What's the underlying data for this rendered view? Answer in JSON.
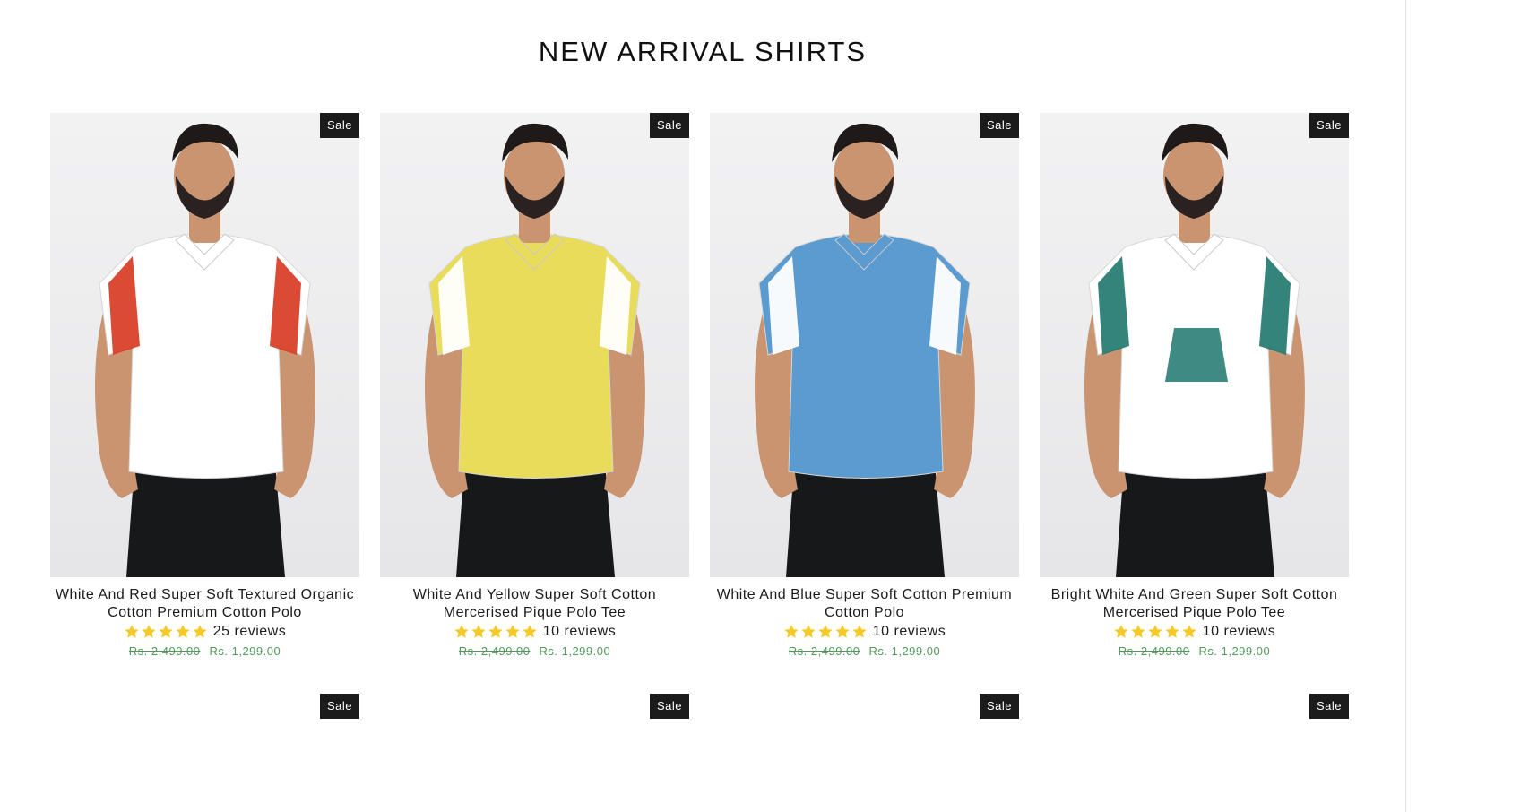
{
  "section": {
    "title": "NEW ARRIVAL SHIRTS"
  },
  "colors": {
    "star": "#f4c928",
    "price": "#4f9a5b",
    "badge_bg": "#1b1b1b"
  },
  "products": [
    {
      "title": "White And Red Super Soft Textured Organic Cotton Premium Cotton Polo",
      "badge": "Sale",
      "rating": 5,
      "reviews": "25 reviews",
      "old_price": "Rs. 2,499.00",
      "new_price": "Rs. 1,299.00",
      "shirt_color": "#ffffff",
      "accent_color": "#d9402a"
    },
    {
      "title": "White And Yellow Super Soft Cotton Mercerised Pique Polo Tee",
      "badge": "Sale",
      "rating": 5,
      "reviews": "10 reviews",
      "old_price": "Rs. 2,499.00",
      "new_price": "Rs. 1,299.00",
      "shirt_color": "#e9dc5a",
      "accent_color": "#ffffff"
    },
    {
      "title": "White And Blue Super Soft Cotton Premium Cotton Polo",
      "badge": "Sale",
      "rating": 5,
      "reviews": "10 reviews",
      "old_price": "Rs. 2,499.00",
      "new_price": "Rs. 1,299.00",
      "shirt_color": "#5b9bcf",
      "accent_color": "#ffffff"
    },
    {
      "title": "Bright White And Green Super Soft Cotton Mercerised Pique Polo Tee",
      "badge": "Sale",
      "rating": 5,
      "reviews": "10 reviews",
      "old_price": "Rs. 2,499.00",
      "new_price": "Rs. 1,299.00",
      "shirt_color": "#ffffff",
      "accent_color": "#2a7d74"
    }
  ],
  "next_row": [
    {
      "badge": "Sale"
    },
    {
      "badge": "Sale"
    },
    {
      "badge": "Sale"
    },
    {
      "badge": "Sale"
    }
  ]
}
